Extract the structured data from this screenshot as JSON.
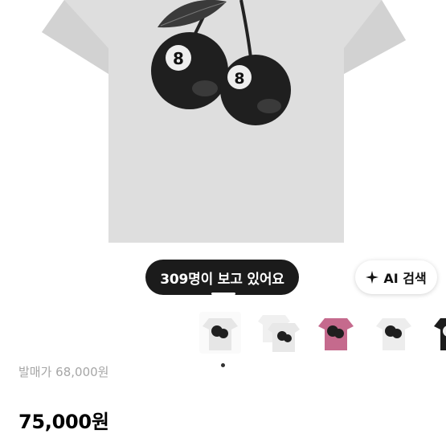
{
  "product": {
    "main_image": "white-tshirt-8ball-cherry-print",
    "viewers_text": "309명이 보고 있어요",
    "ai_search_label": "AI 검색",
    "ai_icon": "sparkle-icon",
    "thumbnails": [
      {
        "name": "thumb-white-front",
        "color": "#e6e6e6"
      },
      {
        "name": "thumb-white-layered",
        "color": "#f0f0f0"
      },
      {
        "name": "thumb-pink",
        "color": "#c56a8d"
      },
      {
        "name": "thumb-white-alt",
        "color": "#ededed"
      },
      {
        "name": "thumb-black",
        "color": "#1c1c1c"
      }
    ],
    "carousel_active_index": 0,
    "msrp_label": "발매가 68,000원",
    "price": "75,000원"
  }
}
